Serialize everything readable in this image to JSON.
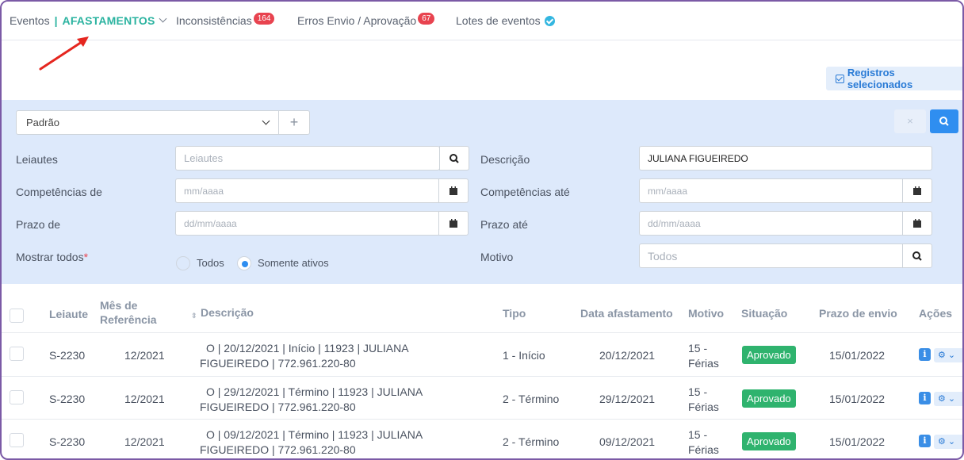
{
  "nav": {
    "eventos": "Eventos",
    "sep": "|",
    "afastamentos": "AFASTAMENTOS",
    "inconsistencias": "Inconsistências",
    "inconsistencias_count": "164",
    "erros": "Erros Envio / Aprovação",
    "erros_count": "67",
    "lotes": "Lotes de eventos"
  },
  "toolbar": {
    "registros": "Registros selecionados"
  },
  "filter": {
    "preset": "Padrão",
    "add": "+",
    "clear": "×",
    "leiautes_label": "Leiautes",
    "leiautes_placeholder": "Leiautes",
    "descricao_label": "Descrição",
    "descricao_value": "JULIANA FIGUEIREDO",
    "comp_de_label": "Competências de",
    "comp_de_placeholder": "mm/aaaa",
    "comp_ate_label": "Competências até",
    "comp_ate_placeholder": "mm/aaaa",
    "prazo_de_label": "Prazo de",
    "prazo_de_placeholder": "dd/mm/aaaa",
    "prazo_ate_label": "Prazo até",
    "prazo_ate_placeholder": "dd/mm/aaaa",
    "mostrar_label": "Mostrar todos",
    "required": "*",
    "todos": "Todos",
    "somente_ativos": "Somente ativos",
    "motivo_label": "Motivo",
    "motivo_placeholder": "Todos"
  },
  "table": {
    "headers": {
      "leiaute": "Leiaute",
      "mes1": "Mês de",
      "mes2": "Referência",
      "descricao": "Descrição",
      "tipo": "Tipo",
      "data": "Data afastamento",
      "motivo": "Motivo",
      "situacao": "Situação",
      "prazo": "Prazo de envio",
      "acoes": "Ações"
    },
    "rows": [
      {
        "leiaute": "S-2230",
        "mes": "12/2021",
        "desc1": "O   | 20/12/2021 | Início | 11923 | JULIANA",
        "desc2": "FIGUEIREDO | 772.961.220-80",
        "tipo": "1 - Início",
        "data": "20/12/2021",
        "motivo1": "15 -",
        "motivo2": "Férias",
        "situacao": "Aprovado",
        "prazo": "15/01/2022"
      },
      {
        "leiaute": "S-2230",
        "mes": "12/2021",
        "desc1": "O   | 29/12/2021 | Término | 11923 | JULIANA",
        "desc2": "FIGUEIREDO | 772.961.220-80",
        "tipo": "2 - Término",
        "data": "29/12/2021",
        "motivo1": "15 -",
        "motivo2": "Férias",
        "situacao": "Aprovado",
        "prazo": "15/01/2022"
      },
      {
        "leiaute": "S-2230",
        "mes": "12/2021",
        "desc1": "O   | 09/12/2021 | Término | 11923 | JULIANA",
        "desc2": "FIGUEIREDO | 772.961.220-80",
        "tipo": "2 - Término",
        "data": "09/12/2021",
        "motivo1": "15 -",
        "motivo2": "Férias",
        "situacao": "Aprovado",
        "prazo": "15/01/2022"
      }
    ]
  },
  "colors": {
    "accent": "#2bb3a0",
    "primary": "#2f8ef0",
    "badge": "#e8434f",
    "approved": "#2fb36e",
    "filter_bg": "#dde9fb"
  }
}
